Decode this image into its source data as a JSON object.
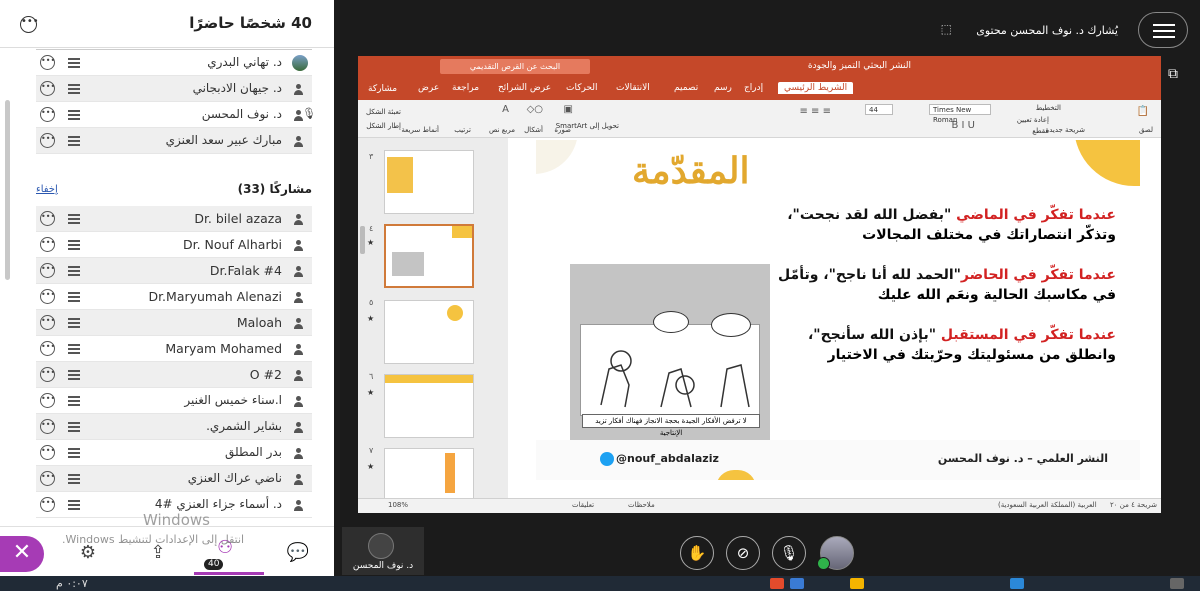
{
  "panel": {
    "title": "40 شخصًا حاضرًا",
    "moderators": [
      "د. تهاني البدري",
      "د. جيهان الادبجاني",
      "د. نوف المحسن",
      "مبارك عبير سعد العنزي"
    ],
    "participants_label": "مشاركًا (33)",
    "hide_label": "إخفاء",
    "participants": [
      "Dr. bilel azaza",
      "Dr. Nouf Alharbi",
      "Dr.Falak #4",
      "Dr.Maryumah Alenazi",
      "Maloah",
      "Maryam Mohamed",
      "O #2",
      "ا.سناء خميس الغنير",
      "بشاير الشمري.",
      "بدر المطلق",
      "ناضي عراك العنزي",
      "د. أسماء جزاء العنزي #4"
    ],
    "watermark_title": "Windows",
    "watermark_sub": "انتقل إلى الإعدادات لتنشيط Windows.",
    "people_count": "40"
  },
  "stage": {
    "share_text": "يُشارك د. نوف المحسن محتوى",
    "presenter_name": "د. نوف المحسن"
  },
  "ppt": {
    "doc_title": "النشر البحثي التميز والجودة",
    "search_placeholder": "البحث عن القرص التقديمي",
    "tabs": [
      "الشريط الرئيسي",
      "إدراج",
      "رسم",
      "تصميم",
      "الانتقالات",
      "الحركات",
      "عرض الشرائح",
      "مراجعة",
      "عرض"
    ],
    "share_btn": "مشاركة",
    "font_name": "Times New Roman",
    "font_size": "44",
    "ribbon": {
      "paste": "لصق",
      "new_slide": "شريحة جديدة",
      "reset": "إعادة تعيين",
      "section": "مقطع",
      "layout": "التخطيط",
      "shapes": "أشكال",
      "textbox": "مربع نص",
      "arrange": "ترتيب",
      "picture": "صورة",
      "fill": "تعبئة الشكل",
      "outline": "إطار الشكل",
      "quick_styles": "أنماط سريعة",
      "smartart": "تحويل إلى SmartArt"
    },
    "thumb_numbers": [
      "٣",
      "٤",
      "٥",
      "٦",
      "٧"
    ],
    "zoom": "108%",
    "notes": "ملاحظات",
    "comments": "تعليقات",
    "slide_info": "شريحة ٤ من ٢٠",
    "language": "العربية (المملكة العربية السعودية)"
  },
  "slide": {
    "title": "المقدّمة",
    "p1_red": "عندما تفكّر في الماضي",
    "p1_black": " \"بفضل الله لقد نجحت\"،",
    "p1_line2": "وتذكّر انتصاراتك في مختلف المجالات",
    "p2_red": "عندما تفكّر في الحاضر",
    "p2_black": "\"الحمد لله أنا ناجح\"، وتأمّل",
    "p2_line2": "في مكاسبك الحالية ونعَم الله عليك",
    "p3_red": "عندما تفكّر في المستقبل",
    "p3_black": " \"بإذن الله سأنجح\"،",
    "p3_line2": "وانطلق من مسئوليتك وحرّيتك في الاختيار",
    "caption": "لا ترفض الأفكار الجيدة بحجة الانجاز فهناك أفكار تزيد الإنتاجية",
    "footer_author": "النشر العلمي  –  د. نوف المحسن",
    "footer_handle": "@nouf_abdalaziz"
  },
  "taskbar": {
    "time": "٠:٠٧ م"
  },
  "colors": {
    "accent": "#a63bb5",
    "ppt_orange": "#c54829",
    "slide_gold": "#e2a82e",
    "slide_red": "#d22222"
  }
}
